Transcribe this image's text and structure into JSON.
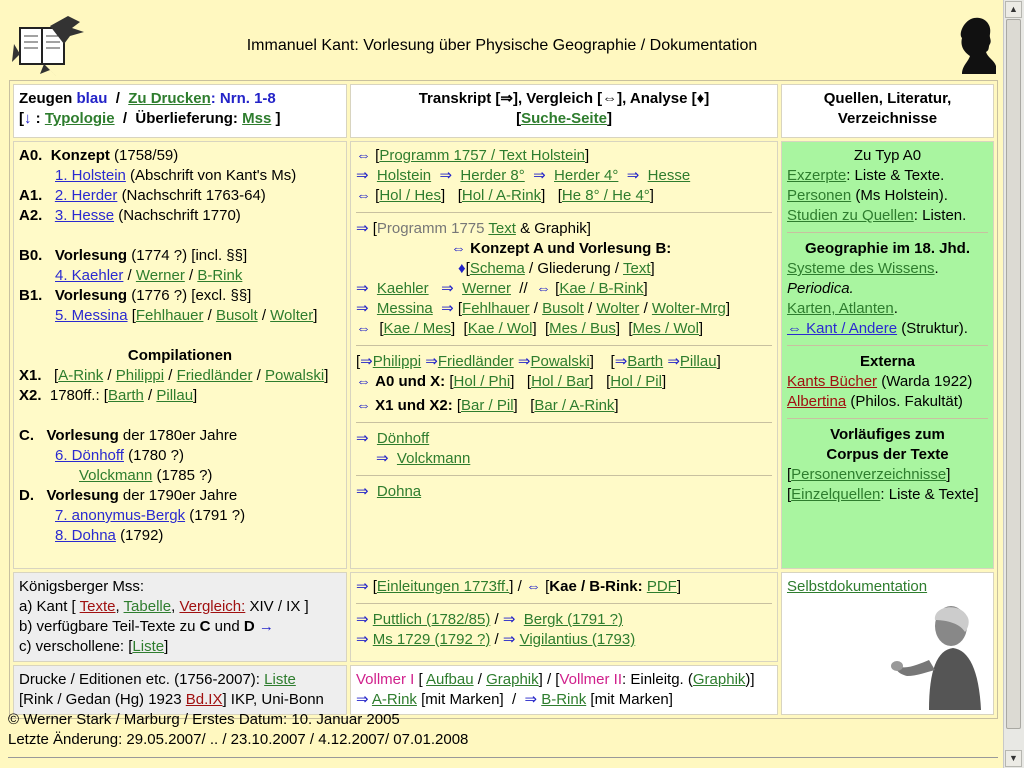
{
  "title": "Immanuel Kant: Vorlesung über Physische Geographie / Dokumentation",
  "header_left": {
    "zeugen": "Zeugen",
    "blau": "blau",
    "slash": "/",
    "zu_drucken": "Zu Drucken",
    "nrn": "Nrn. 1-8",
    "bracket_open": "[",
    "down": "↓",
    "typologie": "Typologie",
    "ueberlieferung": "Überlieferung:",
    "mss": "Mss",
    "bracket_close": "]"
  },
  "header_mid": {
    "line1": "Transkript [⇒], Vergleich [⇔], Analyse [♦]",
    "suche": "Suche-Seite"
  },
  "header_right": {
    "line1": "Quellen, Literatur,",
    "line2": "Verzeichnisse"
  },
  "left": {
    "a0_label": "A0.",
    "a0_title": "Konzept",
    "a0_year": "(1758/59)",
    "holstein": "1. Holstein",
    "holstein_note": "(Abschrift von Kant's Ms)",
    "a1_label": "A1.",
    "herder": "2. Herder",
    "herder_note": "(Nachschrift 1763-64)",
    "a2_label": "A2.",
    "hesse": "3. Hesse",
    "hesse_note": "(Nachschrift 1770)",
    "b0_label": "B0.",
    "b0_title": "Vorlesung",
    "b0_year": "(1774 ?) [incl. §§]",
    "kaehler": "4. Kaehler",
    "werner": "Werner",
    "brink": "B-Rink",
    "b1_label": "B1.",
    "b1_title": "Vorlesung",
    "b1_year": "(1776 ?) [excl. §§]",
    "messina": "5. Messina",
    "fehlhauer": "Fehlhauer",
    "busolt": "Busolt",
    "wolter": "Wolter",
    "compilationen": "Compilationen",
    "x1_label": "X1.",
    "arink": "A-Rink",
    "philippi": "Philippi",
    "friedlaender": "Friedländer",
    "powalski": "Powalski",
    "x2_label": "X2.",
    "x2_year": "1780ff.:",
    "barth": "Barth",
    "pillau": "Pillau",
    "c_label": "C.",
    "c_title": "Vorlesung",
    "c_rest": "der 1780er Jahre",
    "doenhoff": "6. Dönhoff",
    "doenhoff_year": "(1780 ?)",
    "volckmann": "Volckmann",
    "volckmann_year": "(1785 ?)",
    "d_label": "D.",
    "d_title": "Vorlesung",
    "d_rest": "der 1790er Jahre",
    "anonymus": "7. anonymus-Bergk",
    "anonymus_year": "(1791 ?)",
    "dohna": "8. Dohna",
    "dohna_year": "(1792)"
  },
  "mid": {
    "prog1757": "Programm 1757 / Text Holstein",
    "holstein": "Holstein",
    "herder8": "Herder 8°",
    "herder4": "Herder 4°",
    "hesse": "Hesse",
    "hol_hes": "Hol / Hes",
    "hol_arink": "Hol / A-Rink",
    "he8_he4": "He 8° / He 4°",
    "prog1775": "Programm 1775",
    "text": "Text",
    "graphik_amp": "& Graphik]",
    "konzept_line": "Konzept A und Vorlesung B:",
    "schema": "Schema",
    "gliederung": "Gliederung",
    "text2": "Text",
    "kaehler": "Kaehler",
    "werner": "Werner",
    "kae_brink": "Kae / B-Rink",
    "messina": "Messina",
    "fehlhauer": "Fehlhauer",
    "busolt": "Busolt",
    "wolter": "Wolter",
    "wolter_mrg": "Wolter-Mrg",
    "kae_mes": "Kae / Mes",
    "kae_wol": "Kae / Wol",
    "mes_bus": "Mes / Bus",
    "mes_wol": "Mes / Wol",
    "philippi": "Philippi",
    "friedlaender": "Friedländer",
    "powalski": "Powalski",
    "barth": "Barth",
    "pillau": "Pillau",
    "a0_x": "A0 und X:",
    "hol_phi": "Hol / Phi",
    "hol_bar": "Hol / Bar",
    "hol_pil": "Hol / Pil",
    "x1_x2": "X1 und X2:",
    "bar_pil": "Bar / Pil",
    "bar_arink": "Bar / A-Rink",
    "doenhoff": "Dönhoff",
    "volckmann": "Volckmann",
    "dohna": "Dohna"
  },
  "right": {
    "zu_typ": "Zu Typ A0",
    "exzerpte": "Exzerpte",
    "exzerpte_rest": ": Liste & Texte.",
    "personen": "Personen",
    "personen_rest": "(Ms Holstein).",
    "studien": "Studien zu Quellen",
    "studien_rest": ": Listen.",
    "geo18": "Geographie im 18. Jhd.",
    "systeme": "Systeme des Wissens",
    "periodica": "Periodica.",
    "karten": "Karten, Atlanten",
    "kant_andere": "⇔ Kant / Andere",
    "struktur": "(Struktur).",
    "externa": "Externa",
    "kants_buecher": "Kants Bücher",
    "warda": "(Warda 1922)",
    "albertina": "Albertina",
    "philos": "(Philos. Fakultät)",
    "vorl1": "Vorläufiges zum",
    "vorl2": "Corpus der Texte",
    "personenverz": "Personenverzeichnisse",
    "einzelquellen": "Einzelquellen",
    "einzel_rest": ": Liste & Texte]"
  },
  "row2": {
    "koenigsberger": "Königsberger Mss:",
    "a_kant": "a) Kant [",
    "texte": "Texte",
    "tabelle": "Tabelle",
    "vergleich": "Vergleich:",
    "xiv": "XIV / IX ]",
    "b_line": "b) verfügbare Teil-Texte zu",
    "c": "C",
    "und": "und",
    "d": "D",
    "arrow": "→",
    "c_verschollen": "c) verschollene: [",
    "liste": "Liste",
    "einleitungen": "Einleitungen 1773ff.",
    "kae_brink_pdf": "Kae / B-Rink:",
    "pdf": "PDF",
    "puttlich": "Puttlich (1782/85)",
    "bergk": "Bergk (1791 ?)",
    "ms1729": "Ms 1729 (1792 ?)",
    "vigilantius": "Vigilantius (1793)",
    "selbst": "Selbstdokumentation"
  },
  "row3": {
    "drucke": "Drucke / Editionen etc. (1756-2007):",
    "liste": "Liste",
    "rink": "[Rink / Gedan (Hg) 1923",
    "bdix": "Bd.IX",
    "ikp": "] IKP, Uni-Bonn",
    "vollmer1": "Vollmer I",
    "aufbau": "Aufbau",
    "graphik": "Graphik",
    "vollmer2": "Vollmer II",
    "einleitg": ": Einleitg. (",
    "graphik2": "Graphik",
    "arink": "A-Rink",
    "mit_marken": "[mit Marken]",
    "brink": "B-Rink",
    "mit_marken2": "[mit Marken]"
  },
  "footer": {
    "line1": "© Werner Stark / Marburg / Erstes Datum: 10. Januar 2005",
    "line2": "Letzte Änderung: 29.05.2007/ .. / 23.10.2007 / 4.12.2007/ 07.01.2008"
  }
}
